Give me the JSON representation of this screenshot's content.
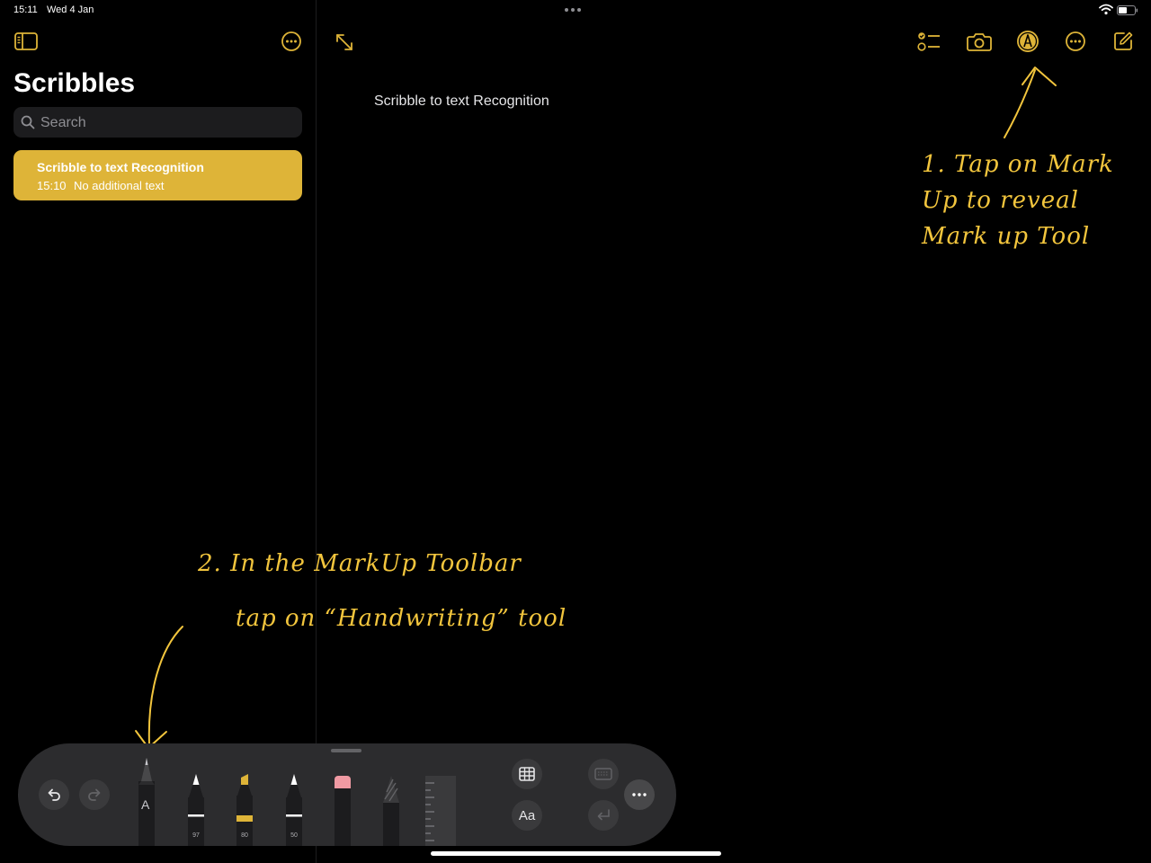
{
  "status_bar": {
    "time": "15:11",
    "date": "Wed 4 Jan"
  },
  "sidebar": {
    "title": "Scribbles",
    "search_placeholder": "Search",
    "notes": [
      {
        "title": "Scribble to text Recognition",
        "time": "15:10",
        "preview": "No additional text"
      }
    ]
  },
  "note": {
    "title": "Scribble to text Recognition"
  },
  "annotations": {
    "step1": "1. Tap on Mark Up to reveal Mark up Tool",
    "step2_line1": "2. In the MarkUp Toolbar",
    "step2_line2": "tap on “Handwriting” tool"
  },
  "toolbar": {
    "pen_width": "97",
    "marker_width": "80",
    "pencil_width": "50",
    "handwriting_glyph": "A",
    "text_button_label": "Aa"
  },
  "colors": {
    "accent": "#deb438",
    "annotation": "#f2c53d",
    "toolbar_bg": "#2c2c2e",
    "button_bg": "#3a3a3c"
  },
  "icons": {
    "sidebar_toggle": "sidebar-icon",
    "more": "ellipsis-circle-icon",
    "expand": "expand-arrows-icon",
    "checklist": "checklist-icon",
    "camera": "camera-icon",
    "markup": "markup-pen-icon",
    "compose": "compose-icon",
    "search": "search-icon",
    "undo": "undo-icon",
    "redo": "redo-icon",
    "table": "table-icon",
    "keyboard": "keyboard-icon",
    "return": "return-icon"
  }
}
